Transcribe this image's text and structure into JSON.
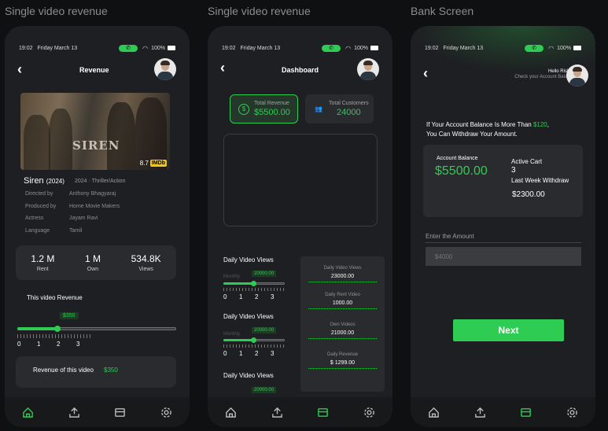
{
  "labels": [
    "Single video revenue",
    "Single video revenue",
    "Bank Screen"
  ],
  "status": {
    "time": "19:02",
    "date": "Friday March 13",
    "battery": "100%"
  },
  "screen1": {
    "title": "Revenue",
    "poster_text": "SIREN",
    "rating": "8.7",
    "imdb": "IMDb",
    "movie_title": "Siren",
    "movie_year": "(2024)",
    "movie_meta": "2024 · Thriller/Action",
    "info": [
      {
        "label": "Directed by",
        "value": "Anthony Bhagyaraj"
      },
      {
        "label": "Produced by",
        "value": "Home Movie Makers"
      },
      {
        "label": "Actress",
        "value": "Jayam Ravi"
      },
      {
        "label": "Language",
        "value": "Tamil"
      }
    ],
    "stats": [
      {
        "value": "1.2 M",
        "label": "Rent"
      },
      {
        "value": "1 M",
        "label": "Own"
      },
      {
        "value": "534.8K",
        "label": "Views"
      }
    ],
    "revenue_label": "This video Revenue",
    "slider_badge": "$350",
    "slider_level": 0.25,
    "slider_nums": [
      "0",
      "1",
      "2",
      "3"
    ],
    "footer_label": "Revenue of this video",
    "footer_value": "$350"
  },
  "screen2": {
    "title": "Dashboard",
    "total_revenue_label": "Total Revenue",
    "total_revenue_value": "$5500.00",
    "total_customers_label": "Total Customers",
    "total_customers_value": "24000",
    "daily_views_label": "Daily Video Views",
    "monthly_label": "Monthly",
    "slider_value": "20000.00",
    "slider_nums": [
      "0",
      "1",
      "2",
      "3"
    ],
    "panel": [
      {
        "title": "Daily Video Views",
        "value": "23000.00"
      },
      {
        "title": "Daily Rent Video",
        "value": "1000.00"
      },
      {
        "title": "Own Videos",
        "value": "21000.00"
      },
      {
        "title": "Daily Revenue",
        "value": "$ 1299.00"
      }
    ]
  },
  "screen3": {
    "greeting": "Hello Rishan",
    "greeting_sub": "Check your Account Balance",
    "notice_prefix": "If Your Account Balance Is More Than ",
    "notice_amount": "$120",
    "notice_suffix": ",",
    "notice_line2": "You Can Withdraw Your Amount.",
    "balance_label": "Account Balance",
    "balance_value": "$5500.00",
    "active_cart_label": "Active Cart",
    "active_cart_value": "3",
    "last_week_label": "Last Week Withdraw",
    "last_week_value": "$2300.00",
    "amount_label": "Enter the Amount",
    "amount_placeholder": "$4000",
    "next_label": "Next"
  },
  "nav_icons": [
    "home-icon",
    "upload-icon",
    "card-icon",
    "settings-icon"
  ],
  "colors": {
    "accent": "#2ecc52",
    "phone_bg": "#1e1f22",
    "card_bg": "#2a2b2f"
  }
}
